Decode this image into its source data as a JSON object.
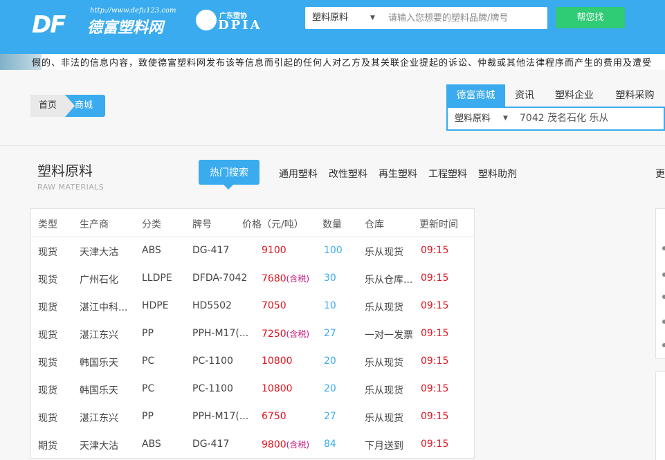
{
  "header": {
    "logo": {
      "url_text": "http://www.defu123.com",
      "mark": "DF",
      "name": "德富塑料网"
    },
    "partner": {
      "cn": "广东塑协",
      "en": "DPIA"
    },
    "search": {
      "category": "塑料原料",
      "placeholder": "请输入您想要的塑料品牌/牌号"
    },
    "search_button": "帮您找",
    "ticker": "假的、非法的信息内容，致使德富塑料网发布该等信息而引起的任何人对乙方及其关联企业提起的诉讼、仲裁或其他法律程序而产生的费用及遭受"
  },
  "breadcrumb": {
    "home": "首页",
    "current": "商城"
  },
  "right_panel": {
    "tabs": [
      "德富商城",
      "资讯",
      "塑料企业",
      "塑料采购"
    ],
    "active_tab": 0,
    "search": {
      "category": "塑料原料",
      "value": "7042 茂名石化 乐从"
    }
  },
  "section": {
    "title": "塑料原料",
    "subtitle": "RAW MATERIALS",
    "hot_label": "热门搜索",
    "categories": [
      "通用塑料",
      "改性塑料",
      "再生塑料",
      "工程塑料",
      "塑料助剂"
    ],
    "more": "更"
  },
  "table": {
    "headers": [
      "类型",
      "生产商",
      "分类",
      "牌号",
      "价格（元/吨）",
      "数量",
      "仓库",
      "更新时间"
    ],
    "tax_label": "(含税)",
    "rows": [
      {
        "type": "现货",
        "maker": "天津大沽",
        "class": "ABS",
        "grade": "DG-417",
        "price": "9100",
        "tax": false,
        "qty": "100",
        "store": "乐从现货",
        "time": "09:15"
      },
      {
        "type": "现货",
        "maker": "广州石化",
        "class": "LLDPE",
        "grade": "DFDA-7042",
        "price": "7680",
        "tax": true,
        "qty": "30",
        "store": "乐从仓库...",
        "time": "09:15"
      },
      {
        "type": "现货",
        "maker": "湛江中科...",
        "class": "HDPE",
        "grade": "HD5502",
        "price": "7050",
        "tax": false,
        "qty": "10",
        "store": "乐从现货",
        "time": "09:15"
      },
      {
        "type": "现货",
        "maker": "湛江东兴",
        "class": "PP",
        "grade": "PPH-M17(...",
        "price": "7250",
        "tax": true,
        "qty": "27",
        "store": "一对一发票",
        "time": "09:15"
      },
      {
        "type": "现货",
        "maker": "韩国乐天",
        "class": "PC",
        "grade": "PC-1100",
        "price": "10800",
        "tax": false,
        "qty": "20",
        "store": "乐从现货",
        "time": "09:15"
      },
      {
        "type": "现货",
        "maker": "韩国乐天",
        "class": "PC",
        "grade": "PC-1100",
        "price": "10800",
        "tax": false,
        "qty": "20",
        "store": "乐从现货",
        "time": "09:15"
      },
      {
        "type": "现货",
        "maker": "湛江东兴",
        "class": "PP",
        "grade": "PPH-M17(...",
        "price": "6750",
        "tax": false,
        "qty": "27",
        "store": "乐从现货",
        "time": "09:15"
      },
      {
        "type": "期货",
        "maker": "天津大沽",
        "class": "ABS",
        "grade": "DG-417",
        "price": "9800",
        "tax": true,
        "qty": "84",
        "store": "下月送到",
        "time": "09:15"
      }
    ]
  },
  "colors": {
    "brand": "#3aabee",
    "button": "#2fcb75",
    "price": "#e0151f",
    "tax": "#c3157a"
  }
}
